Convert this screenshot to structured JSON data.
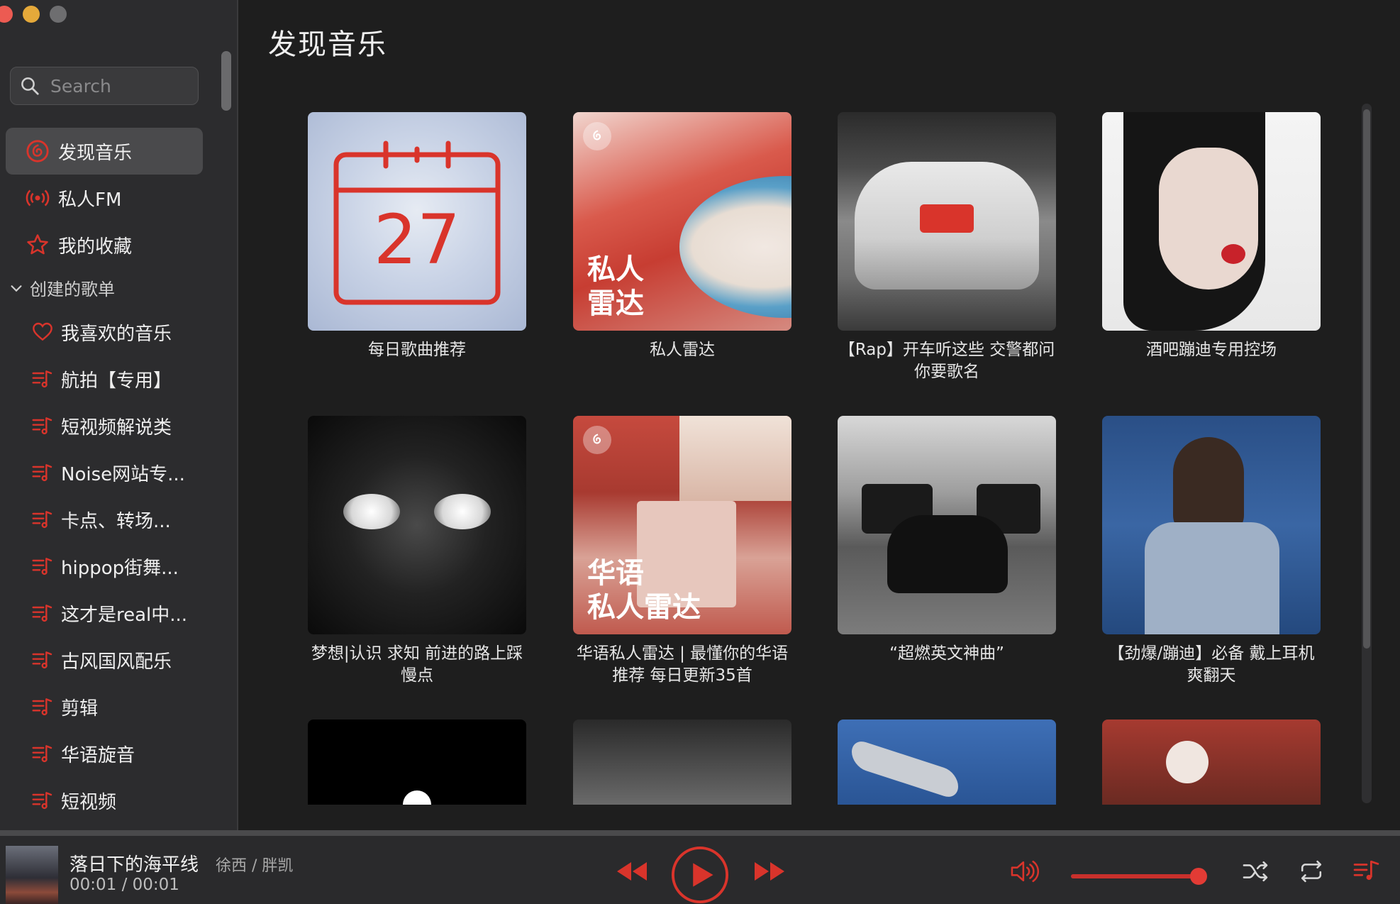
{
  "sidebar": {
    "search_placeholder": "Search",
    "nav": [
      {
        "label": "发现音乐",
        "icon": "netease-icon"
      },
      {
        "label": "私人FM",
        "icon": "radio-icon"
      },
      {
        "label": "我的收藏",
        "icon": "star-icon"
      }
    ],
    "group_title": "创建的歌单",
    "playlists": [
      {
        "label": "我喜欢的音乐",
        "icon": "heart-icon"
      },
      {
        "label": "航拍【专用】",
        "icon": "playlist-icon"
      },
      {
        "label": "短视频解说类",
        "icon": "playlist-icon"
      },
      {
        "label": "Noise网站专...",
        "icon": "playlist-icon"
      },
      {
        "label": "卡点、转场...",
        "icon": "playlist-icon"
      },
      {
        "label": "hippop街舞...",
        "icon": "playlist-icon"
      },
      {
        "label": "这才是real中...",
        "icon": "playlist-icon"
      },
      {
        "label": "古风国风配乐",
        "icon": "playlist-icon"
      },
      {
        "label": "剪辑",
        "icon": "playlist-icon"
      },
      {
        "label": "华语旋音",
        "icon": "playlist-icon"
      },
      {
        "label": "短视频",
        "icon": "playlist-icon"
      }
    ]
  },
  "main": {
    "title": "发现音乐",
    "cards": [
      {
        "title": "每日歌曲推荐",
        "cover_text": "27"
      },
      {
        "title": "私人雷达",
        "cover_text": "私人\n雷达"
      },
      {
        "title": "【Rap】开车听这些 交警都问你要歌名"
      },
      {
        "title": "酒吧蹦迪专用控场"
      },
      {
        "title": "梦想|认识 求知 前进的路上踩慢点"
      },
      {
        "title": "华语私人雷达 | 最懂你的华语推荐 每日更新35首",
        "cover_text": "华语\n私人雷达"
      },
      {
        "title": "“超燃英文神曲”"
      },
      {
        "title": "【劲爆/蹦迪】必备 戴上耳机爽翻天"
      }
    ]
  },
  "player": {
    "song": "落日下的海平线",
    "artist": "徐西 / 胖凯",
    "time": "00:01 / 00:01",
    "volume": 0.92,
    "accent": "#d9342b"
  }
}
